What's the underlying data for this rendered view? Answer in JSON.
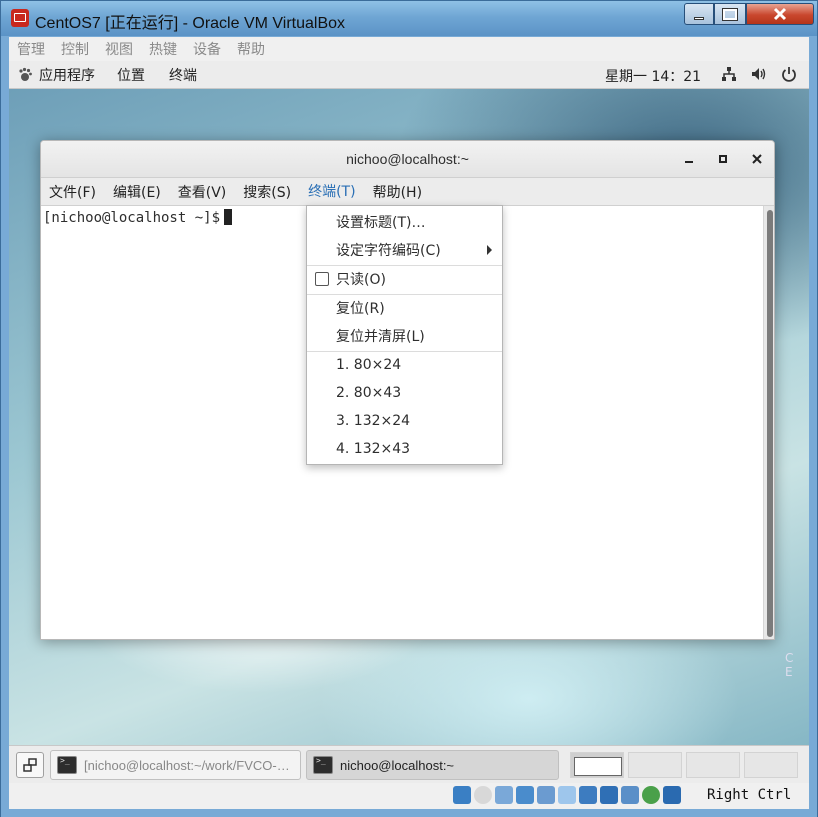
{
  "vbox": {
    "title": "CentOS7 [正在运行] - Oracle VM VirtualBox",
    "menu": [
      "管理",
      "控制",
      "视图",
      "热键",
      "设备",
      "帮助"
    ],
    "host_key": "Right Ctrl"
  },
  "gnome_top": {
    "applications": "应用程序",
    "places": "位置",
    "terminal": "终端",
    "clock": "星期一 14：21"
  },
  "terminal": {
    "title": "nichoo@localhost:~",
    "menu": [
      "文件(F)",
      "编辑(E)",
      "查看(V)",
      "搜索(S)",
      "终端(T)",
      "帮助(H)"
    ],
    "prompt": "[nichoo@localhost ~]$"
  },
  "dropdown": {
    "set_title": "设置标题(T)…",
    "set_encoding": "设定字符编码(C)",
    "read_only": "只读(O)",
    "reset": "复位(R)",
    "reset_clear": "复位并清屏(L)",
    "size1": "1. 80×24",
    "size2": "2. 80×43",
    "size3": "3. 132×24",
    "size4": "4. 132×43"
  },
  "desktop": {
    "corner_text": "C E"
  },
  "taskbar": {
    "task1": "[nichoo@localhost:~/work/FVCO-…",
    "task2": "nichoo@localhost:~"
  },
  "colors": {
    "accent": "#4a90d9",
    "close_red": "#c9472e"
  }
}
